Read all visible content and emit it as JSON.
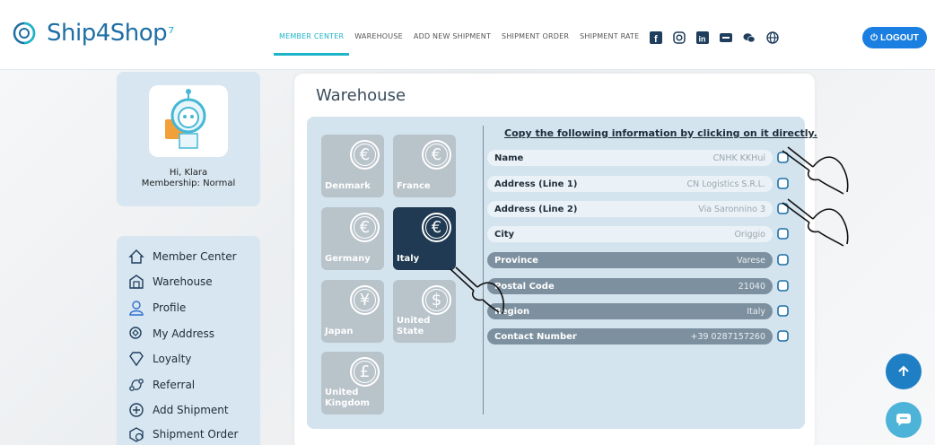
{
  "brand": {
    "name": "Ship4Shop",
    "accent": "#1cb4c9",
    "primary": "#1f6fa5"
  },
  "nav": {
    "items": [
      "MEMBER CENTER",
      "WAREHOUSE",
      "ADD NEW SHIPMENT",
      "SHIPMENT ORDER",
      "SHIPMENT RATE"
    ],
    "active_index": 0
  },
  "social_icons": [
    "facebook-icon",
    "instagram-icon",
    "linkedin-icon",
    "weibo-icon",
    "wechat-icon",
    "globe-icon"
  ],
  "logout": {
    "label": "LOGOUT",
    "color": "#1a7fe0"
  },
  "profile": {
    "greeting": "Hi, Klara",
    "membership": "Membership: Normal"
  },
  "sidebar": {
    "items": [
      {
        "label": "Member Center",
        "icon": "home-icon"
      },
      {
        "label": "Warehouse",
        "icon": "warehouse-icon"
      },
      {
        "label": "Profile",
        "icon": "user-icon"
      },
      {
        "label": "My Address",
        "icon": "address-icon"
      },
      {
        "label": "Loyalty",
        "icon": "diamond-icon"
      },
      {
        "label": "Referral",
        "icon": "referral-icon"
      },
      {
        "label": "Add Shipment",
        "icon": "plus-circle-icon"
      },
      {
        "label": "Shipment Order",
        "icon": "box-icon"
      }
    ]
  },
  "warehouse": {
    "title": "Warehouse",
    "countries": [
      {
        "name": "Denmark",
        "symbol": "€",
        "active": false
      },
      {
        "name": "France",
        "symbol": "€",
        "active": false
      },
      {
        "name": "Germany",
        "symbol": "€",
        "active": false
      },
      {
        "name": "Italy",
        "symbol": "€",
        "active": true
      },
      {
        "name": "Japan",
        "symbol": "¥",
        "active": false
      },
      {
        "name": "United State",
        "symbol": "$",
        "active": false
      },
      {
        "name": "United Kingdom",
        "symbol": "£",
        "active": false
      }
    ],
    "copy_hint": "Copy the following information by clicking on it directly.",
    "fields": [
      {
        "label": "Name",
        "value": "CNHK KKHui",
        "style": "light"
      },
      {
        "label": "Address (Line 1)",
        "value": "CN Logistics S.R.L.",
        "style": "light"
      },
      {
        "label": "Address (Line 2)",
        "value": "Via Saronnino 3",
        "style": "light"
      },
      {
        "label": "City",
        "value": "Origgio",
        "style": "light"
      },
      {
        "label": "Province",
        "value": "Varese",
        "style": "dark"
      },
      {
        "label": "Postal Code",
        "value": "21040",
        "style": "dark"
      },
      {
        "label": "Region",
        "value": "Italy",
        "style": "dark"
      },
      {
        "label": "Contact Number",
        "value": "+39 0287157260",
        "style": "dark"
      }
    ]
  },
  "floating": {
    "scroll_top_icon": "arrow-up-icon",
    "chat_icon": "chat-icon"
  }
}
